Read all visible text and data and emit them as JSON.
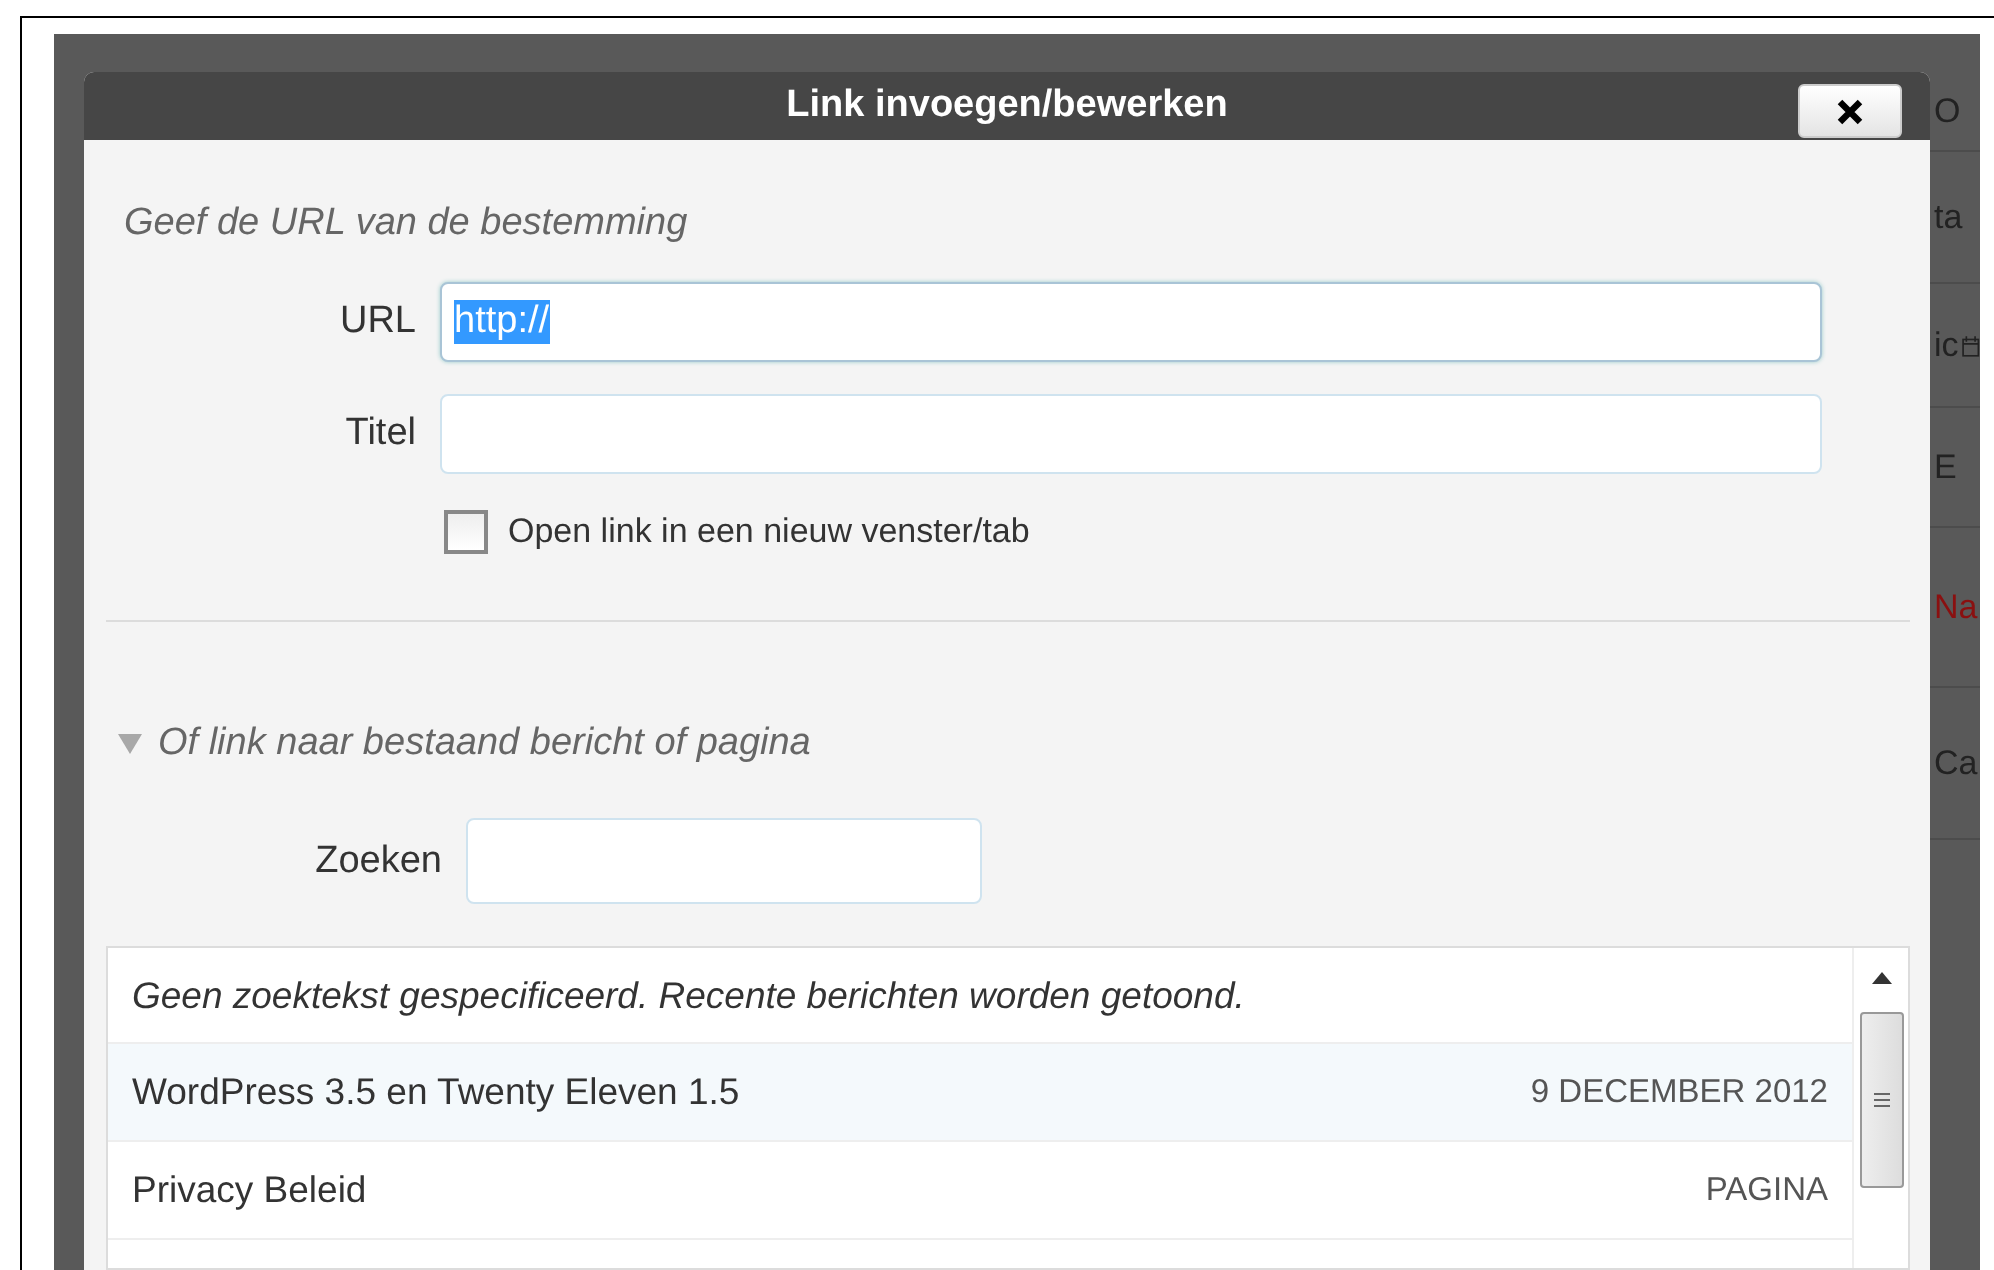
{
  "background": {
    "right_fragments": [
      "O",
      "ta",
      "ic",
      "E",
      "Na",
      "Ca"
    ]
  },
  "dialog": {
    "title": "Link invoegen/bewerken",
    "url_section": {
      "heading": "Geef de URL van de bestemming",
      "url_label": "URL",
      "url_value": "http://",
      "title_label": "Titel",
      "new_window": {
        "label": "Open link in een nieuw venster/tab",
        "checked": false
      }
    },
    "link_section": {
      "heading": "Of link naar bestaand bericht of pagina",
      "expanded": true,
      "search_label": "Zoeken",
      "notice": "Geen zoektekst gespecificeerd. Recente berichten worden getoond.",
      "results": [
        {
          "title": "WordPress 3.5 en Twenty Eleven 1.5",
          "info": "9 DECEMBER 2012"
        },
        {
          "title": "Privacy Beleid",
          "info": "PAGINA"
        }
      ]
    }
  }
}
